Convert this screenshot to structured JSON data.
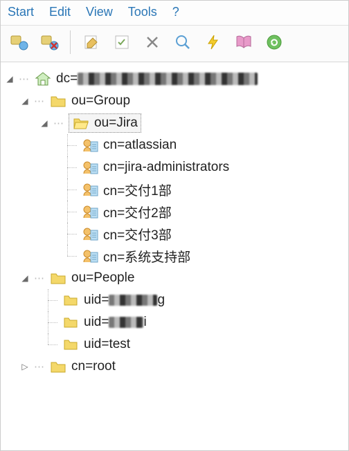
{
  "menu": {
    "start": "Start",
    "edit": "Edit",
    "view": "View",
    "tools": "Tools",
    "help": "?"
  },
  "toolbar": {
    "icons": [
      "connect-icon",
      "disconnect-icon",
      "edit-icon",
      "checklist-icon",
      "delete-icon",
      "search-icon",
      "lightning-icon",
      "book-icon",
      "refresh-icon"
    ]
  },
  "tree": {
    "root": {
      "label_prefix": "dc="
    },
    "group": {
      "label": "ou=Group"
    },
    "jira": {
      "label": "ou=Jira"
    },
    "cns": [
      "cn=atlassian",
      "cn=jira-administrators",
      "cn=交付1部",
      "cn=交付2部",
      "cn=交付3部",
      "cn=系统支持部"
    ],
    "people": {
      "label": "ou=People"
    },
    "uids": {
      "u0_prefix": "uid=",
      "u1_prefix": "uid=",
      "u2": "uid=test"
    },
    "cnroot": {
      "label": "cn=root"
    }
  }
}
